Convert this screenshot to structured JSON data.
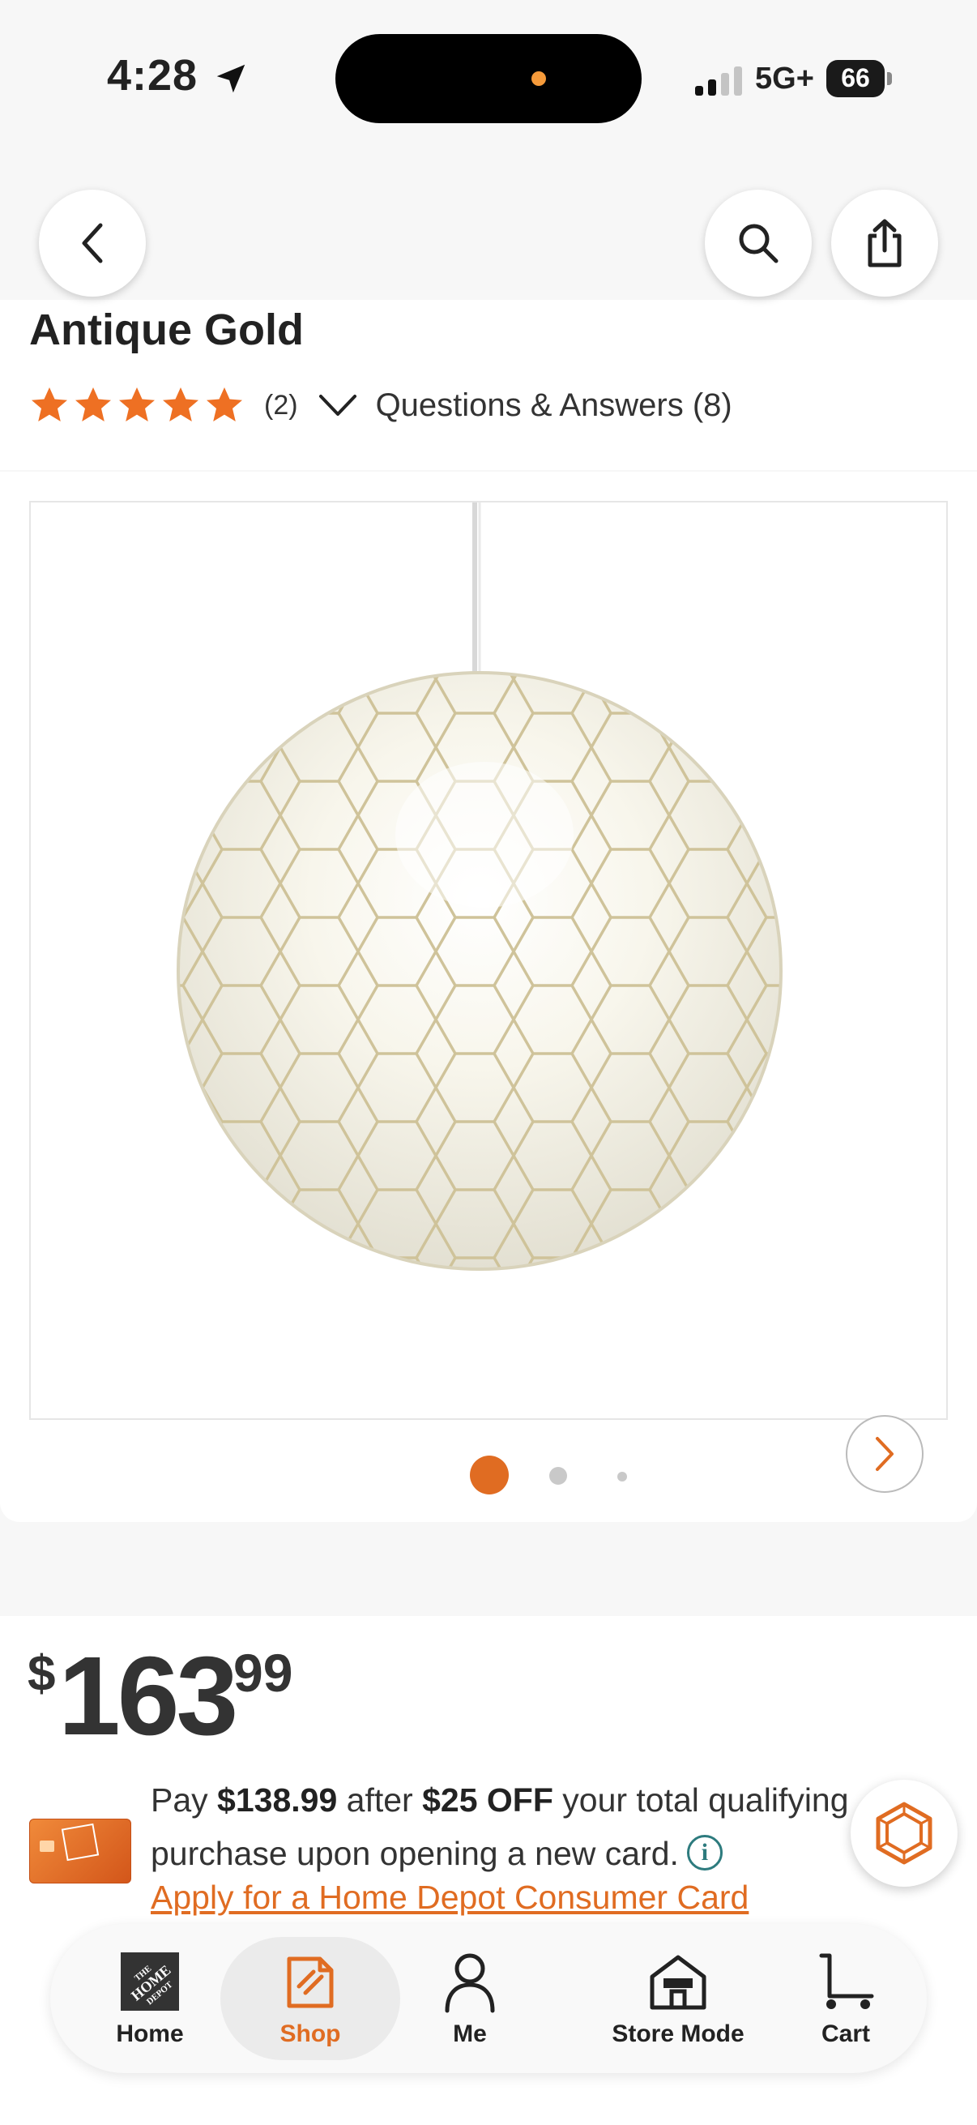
{
  "status_bar": {
    "time": "4:28",
    "network": "5G+",
    "battery": "66"
  },
  "product": {
    "title": "Antique Gold",
    "rating_stars": 5,
    "review_count": "(2)",
    "qa_label": "Questions & Answers (8)"
  },
  "gallery": {
    "image_count": 3,
    "active_index": 0
  },
  "price": {
    "currency": "$",
    "dollars": "163",
    "cents": "99"
  },
  "offer": {
    "pay_prefix": "Pay ",
    "pay_amount": "$138.99",
    "after_text": " after ",
    "discount": "$25 OFF",
    "rest_text": " your total qualifying purchase upon opening a new card.",
    "apply_link": "Apply for a Home Depot Consumer Card"
  },
  "tabbar": {
    "home": "Home",
    "shop": "Shop",
    "me": "Me",
    "store_mode": "Store Mode",
    "cart": "Cart"
  },
  "colors": {
    "accent": "#e06c22",
    "star": "#ee7023",
    "info": "#2d7b7e"
  }
}
